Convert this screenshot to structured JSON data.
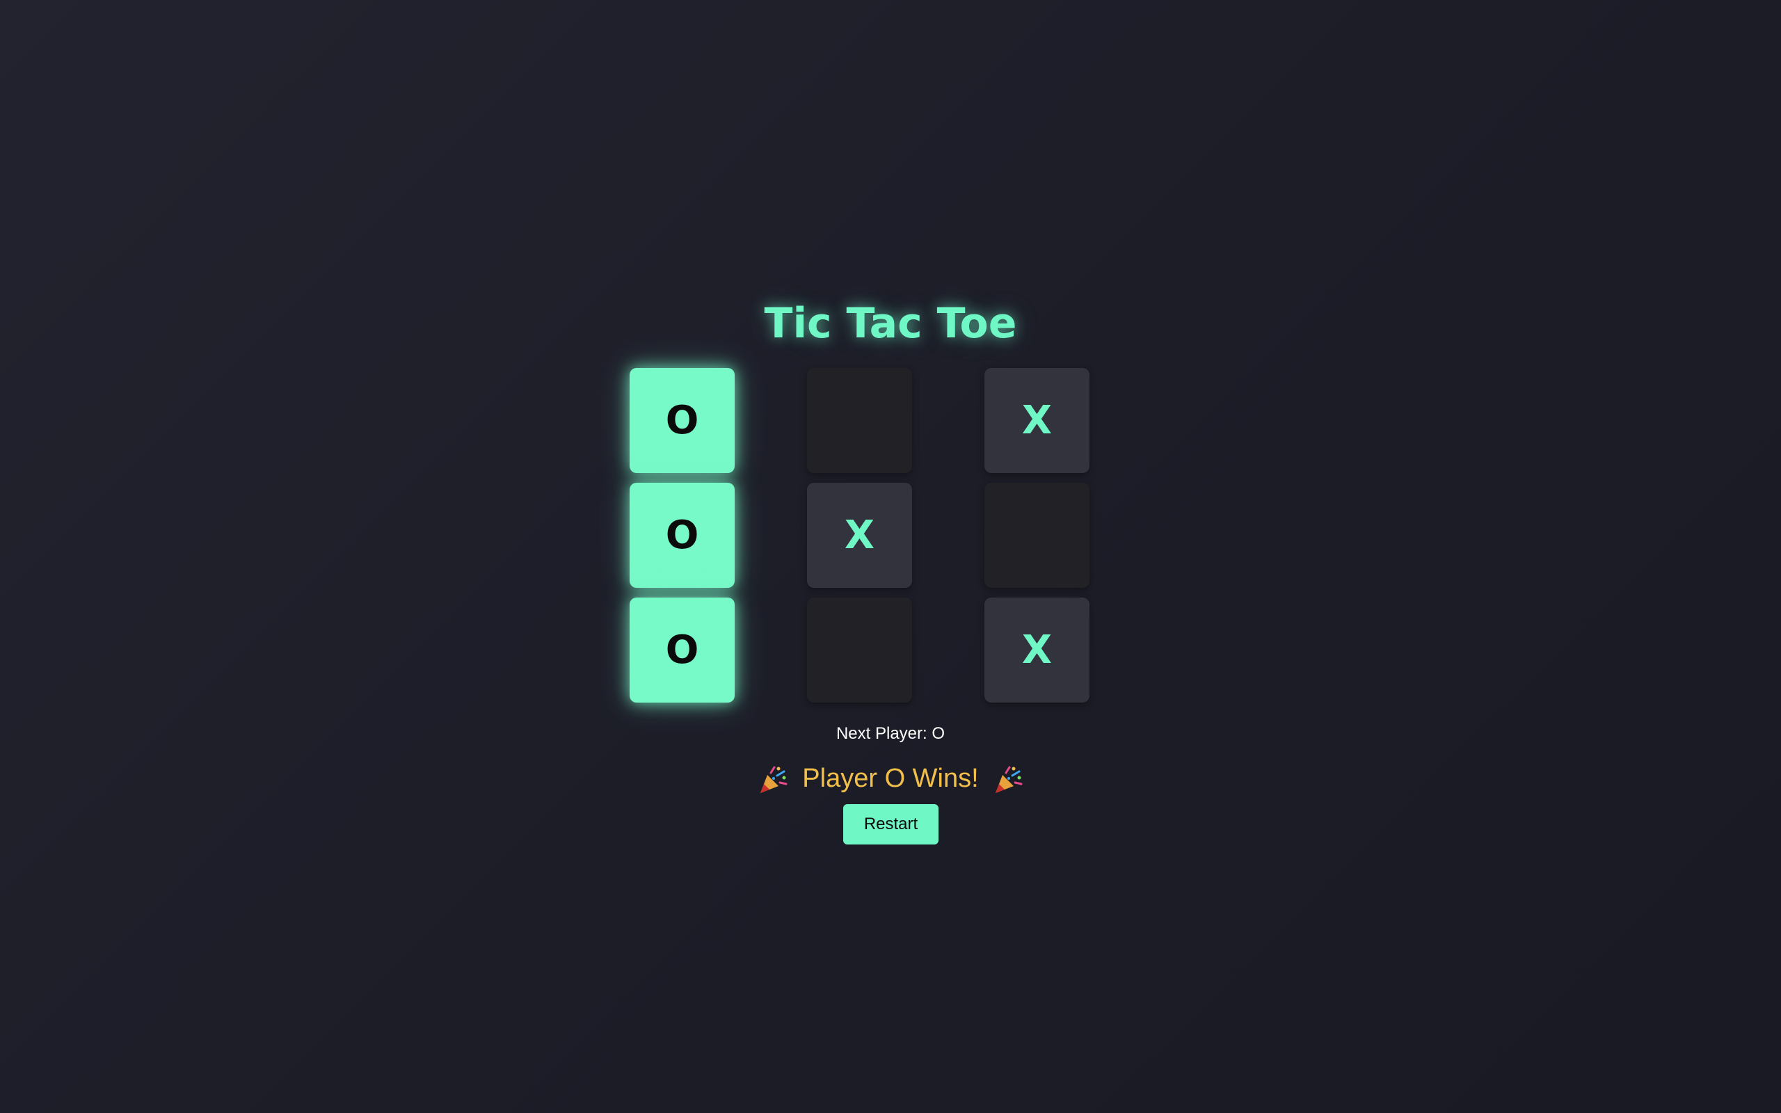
{
  "game": {
    "title": "Tic Tac Toe",
    "board": [
      [
        "O",
        "",
        "X"
      ],
      [
        "O",
        "X",
        ""
      ],
      [
        "O",
        "",
        "X"
      ]
    ],
    "status": "Next Player: O",
    "winner_text": "Player O Wins!",
    "restart_label": "Restart"
  },
  "icons": {
    "celebration": "party-popper-icon"
  },
  "colors": {
    "accent": "#6ff7c6",
    "win_cell": "#78f9c8",
    "winner_text": "#f2c04a",
    "cell_empty": "#222226",
    "cell_x": "#33333e",
    "background": "#1e1e29"
  }
}
